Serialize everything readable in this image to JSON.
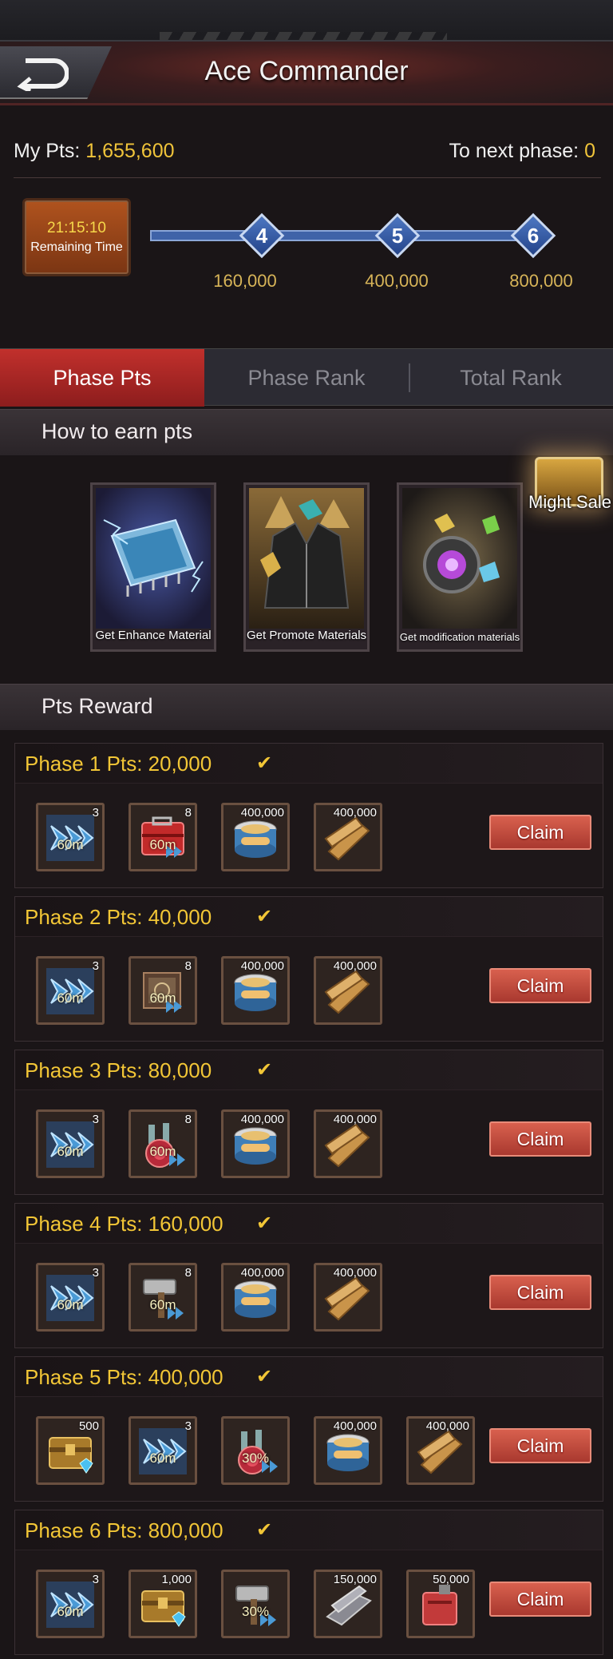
{
  "header": {
    "title": "Ace Commander"
  },
  "stats": {
    "my_pts_label": "My Pts:",
    "my_pts_value": "1,655,600",
    "next_label": "To next phase:",
    "next_value": "0"
  },
  "timer": {
    "time": "21:15:10",
    "label": "Remaining Time"
  },
  "progress": {
    "nodes": [
      {
        "num": "4",
        "value": "160,000"
      },
      {
        "num": "5",
        "value": "400,000"
      },
      {
        "num": "6",
        "value": "800,000"
      }
    ]
  },
  "tabs": [
    {
      "label": "Phase Pts",
      "active": true
    },
    {
      "label": "Phase Rank",
      "active": false
    },
    {
      "label": "Total Rank",
      "active": false
    }
  ],
  "earn": {
    "title": "How to earn pts",
    "cards": [
      {
        "label": "Get Enhance Material",
        "icon": "chip-icon"
      },
      {
        "label": "Get Promote Materials",
        "icon": "jacket-icon"
      },
      {
        "label": "Get modification materials",
        "icon": "orb-icon"
      }
    ],
    "might_sale": "Might Sale"
  },
  "rewards": {
    "title": "Pts Reward",
    "phases": [
      {
        "title": "Phase 1  Pts: 20,000",
        "claim": "Claim",
        "items": [
          {
            "icon": "speedup-arrows-icon",
            "count": "3",
            "time": "60m"
          },
          {
            "icon": "red-toolbox-icon",
            "count": "8",
            "time": "60m"
          },
          {
            "icon": "food-can-icon",
            "count": "400,000"
          },
          {
            "icon": "wood-planks-icon",
            "count": "400,000"
          }
        ]
      },
      {
        "title": "Phase 2  Pts: 40,000",
        "claim": "Claim",
        "items": [
          {
            "icon": "speedup-arrows-icon",
            "count": "3",
            "time": "60m"
          },
          {
            "icon": "blueprint-book-icon",
            "count": "8",
            "time": "60m"
          },
          {
            "icon": "food-can-icon",
            "count": "400,000"
          },
          {
            "icon": "wood-planks-icon",
            "count": "400,000"
          }
        ]
      },
      {
        "title": "Phase 3  Pts: 80,000",
        "claim": "Claim",
        "items": [
          {
            "icon": "speedup-arrows-icon",
            "count": "3",
            "time": "60m"
          },
          {
            "icon": "potion-flasks-icon",
            "count": "8",
            "time": "60m"
          },
          {
            "icon": "food-can-icon",
            "count": "400,000"
          },
          {
            "icon": "wood-planks-icon",
            "count": "400,000"
          }
        ]
      },
      {
        "title": "Phase 4  Pts: 160,000",
        "claim": "Claim",
        "items": [
          {
            "icon": "speedup-arrows-icon",
            "count": "3",
            "time": "60m"
          },
          {
            "icon": "hammer-icon",
            "count": "8",
            "time": "60m"
          },
          {
            "icon": "food-can-icon",
            "count": "400,000"
          },
          {
            "icon": "wood-planks-icon",
            "count": "400,000"
          }
        ]
      },
      {
        "title": "Phase 5  Pts: 400,000",
        "claim": "Claim",
        "items": [
          {
            "icon": "gem-chest-icon",
            "count": "500"
          },
          {
            "icon": "speedup-arrows-icon",
            "count": "3",
            "time": "60m"
          },
          {
            "icon": "potion-flasks-icon",
            "count": "",
            "time": "30%"
          },
          {
            "icon": "food-can-icon",
            "count": "400,000"
          },
          {
            "icon": "wood-planks-icon",
            "count": "400,000"
          }
        ]
      },
      {
        "title": "Phase 6  Pts: 800,000",
        "claim": "Claim",
        "items": [
          {
            "icon": "speedup-arrows-icon",
            "count": "3",
            "time": "60m"
          },
          {
            "icon": "gem-chest-icon",
            "count": "1,000"
          },
          {
            "icon": "hammer-icon",
            "count": "",
            "time": "30%"
          },
          {
            "icon": "steel-beam-icon",
            "count": "150,000"
          },
          {
            "icon": "fuel-canister-icon",
            "count": "50,000"
          }
        ]
      }
    ]
  },
  "colors": {
    "gold": "#f2c636",
    "claim": "#c24b3d",
    "accent_red": "#b52a27",
    "node_blue": "#3f63a8"
  }
}
